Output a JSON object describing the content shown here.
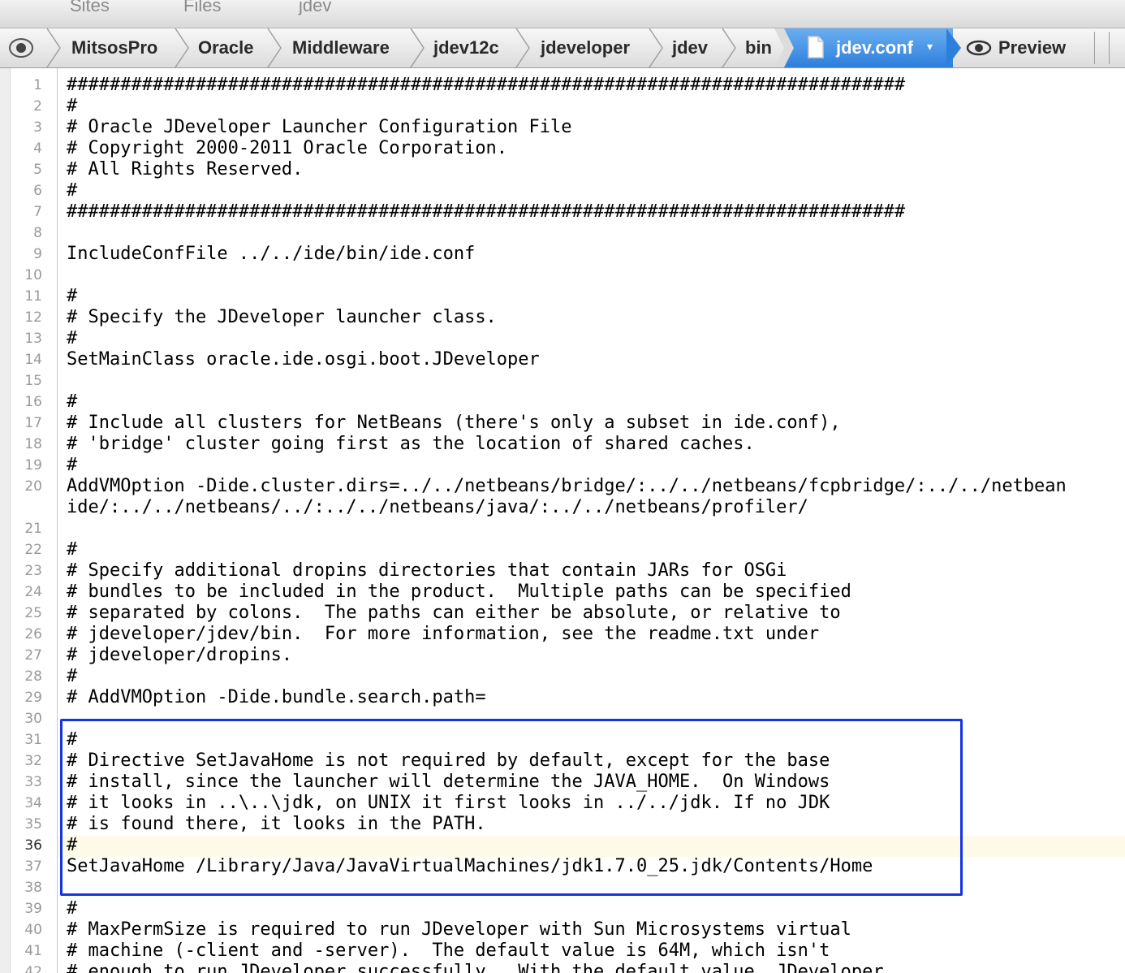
{
  "tabs": [
    "Sites",
    "Files",
    "jdev"
  ],
  "breadcrumb": {
    "items": [
      "MitsosPro",
      "Oracle",
      "Middleware",
      "jdev12c",
      "jdeveloper",
      "jdev",
      "bin"
    ],
    "active_file": "jdev.conf",
    "preview_label": "Preview"
  },
  "editor": {
    "current_line": 36,
    "lines": [
      {
        "n": "1",
        "text": "##############################################################################"
      },
      {
        "n": "2",
        "text": "#"
      },
      {
        "n": "3",
        "text": "# Oracle JDeveloper Launcher Configuration File"
      },
      {
        "n": "4",
        "text": "# Copyright 2000-2011 Oracle Corporation."
      },
      {
        "n": "5",
        "text": "# All Rights Reserved."
      },
      {
        "n": "6",
        "text": "#"
      },
      {
        "n": "7",
        "text": "##############################################################################"
      },
      {
        "n": "8",
        "text": ""
      },
      {
        "n": "9",
        "text": "IncludeConfFile ../../ide/bin/ide.conf"
      },
      {
        "n": "10",
        "text": ""
      },
      {
        "n": "11",
        "text": "#"
      },
      {
        "n": "12",
        "text": "# Specify the JDeveloper launcher class."
      },
      {
        "n": "13",
        "text": "#"
      },
      {
        "n": "14",
        "text": "SetMainClass oracle.ide.osgi.boot.JDeveloper"
      },
      {
        "n": "15",
        "text": ""
      },
      {
        "n": "16",
        "text": "#"
      },
      {
        "n": "17",
        "text": "# Include all clusters for NetBeans (there's only a subset in ide.conf),"
      },
      {
        "n": "18",
        "text": "# 'bridge' cluster going first as the location of shared caches."
      },
      {
        "n": "19",
        "text": "#"
      },
      {
        "n": "20",
        "text": "AddVMOption -Dide.cluster.dirs=../../netbeans/bridge/:../../netbeans/fcpbridge/:../../netbean"
      },
      {
        "n": "",
        "text": "ide/:../../netbeans/../:../../netbeans/java/:../../netbeans/profiler/"
      },
      {
        "n": "21",
        "text": ""
      },
      {
        "n": "22",
        "text": "#"
      },
      {
        "n": "23",
        "text": "# Specify additional dropins directories that contain JARs for OSGi"
      },
      {
        "n": "24",
        "text": "# bundles to be included in the product.  Multiple paths can be specified"
      },
      {
        "n": "25",
        "text": "# separated by colons.  The paths can either be absolute, or relative to"
      },
      {
        "n": "26",
        "text": "# jdeveloper/jdev/bin.  For more information, see the readme.txt under"
      },
      {
        "n": "27",
        "text": "# jdeveloper/dropins."
      },
      {
        "n": "28",
        "text": "#"
      },
      {
        "n": "29",
        "text": "# AddVMOption -Dide.bundle.search.path="
      },
      {
        "n": "30",
        "text": ""
      },
      {
        "n": "31",
        "text": "#"
      },
      {
        "n": "32",
        "text": "# Directive SetJavaHome is not required by default, except for the base"
      },
      {
        "n": "33",
        "text": "# install, since the launcher will determine the JAVA_HOME.  On Windows"
      },
      {
        "n": "34",
        "text": "# it looks in ..\\..\\jdk, on UNIX it first looks in ../../jdk. If no JDK"
      },
      {
        "n": "35",
        "text": "# is found there, it looks in the PATH."
      },
      {
        "n": "36",
        "text": "#"
      },
      {
        "n": "37",
        "text": "SetJavaHome /Library/Java/JavaVirtualMachines/jdk1.7.0_25.jdk/Contents/Home"
      },
      {
        "n": "38",
        "text": ""
      },
      {
        "n": "39",
        "text": "#"
      },
      {
        "n": "40",
        "text": "# MaxPermSize is required to run JDeveloper with Sun Microsystems virtual"
      },
      {
        "n": "41",
        "text": "# machine (-client and -server).  The default value is 64M, which isn't"
      },
      {
        "n": "42",
        "text": "# enough to run JDeveloper successfully.  With the default value, JDeveloper"
      }
    ]
  },
  "colors": {
    "highlight_box": "#1533e6",
    "active_crumb": "#3a8be0",
    "current_line_bg": "#fdfbe8"
  }
}
